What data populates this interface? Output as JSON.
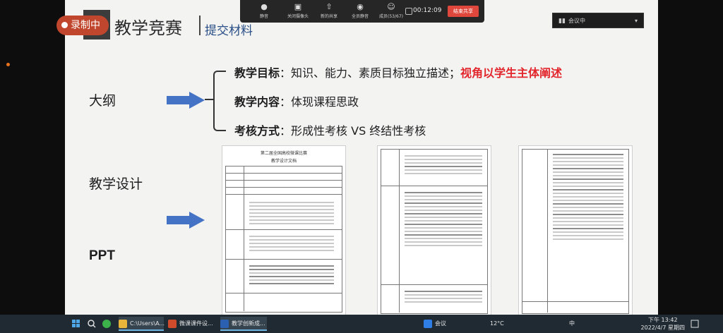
{
  "recording": {
    "label": "录制中"
  },
  "slide": {
    "title": "教学竞赛",
    "subtitle": "提交材料",
    "labels": {
      "outline": "大纲",
      "design": "教学设计",
      "ppt": "PPT"
    },
    "points": [
      {
        "head": "教学目标",
        "sep": "：",
        "text": "知识、能力、素质目标独立描述；",
        "highlight": "视角以学生主体阐述"
      },
      {
        "head": "教学内容",
        "sep": "：",
        "text": "体现课程思政",
        "highlight": ""
      },
      {
        "head": "考核方式",
        "sep": "：",
        "text": "形成性考核 VS 终结性考核",
        "highlight": ""
      }
    ],
    "doc": {
      "title": "第二届全国高校微课比赛",
      "subtitle": "教学设计文档"
    }
  },
  "toolbar": {
    "items": [
      {
        "label": "静音",
        "icon": "mic-icon"
      },
      {
        "label": "关闭摄像头",
        "icon": "camera-icon"
      },
      {
        "label": "新的共享",
        "icon": "share-icon"
      },
      {
        "label": "全员静音",
        "icon": "mute-all-icon"
      },
      {
        "label": "成员(53/67)",
        "icon": "members-icon"
      }
    ],
    "timer": "00:12:09",
    "end_share": "结束共享"
  },
  "meeting_panel": {
    "label": "会议中"
  },
  "taskbar": {
    "items": [
      {
        "label": "C:\\Users\\A...",
        "color": "#e8b53a"
      },
      {
        "label": "微课课件设...",
        "color": "#d04b2b"
      },
      {
        "label": "教学创新成...",
        "color": "#2b5fb0"
      }
    ],
    "meeting_tray": "会议",
    "weather": "12°C",
    "lang": "中",
    "time": "下午 13:42",
    "date": "2022/4/7 星期四"
  },
  "colors": {
    "accent_red": "#e2262c",
    "arrow_blue": "#4472c4",
    "rec_red": "#c0472d"
  }
}
